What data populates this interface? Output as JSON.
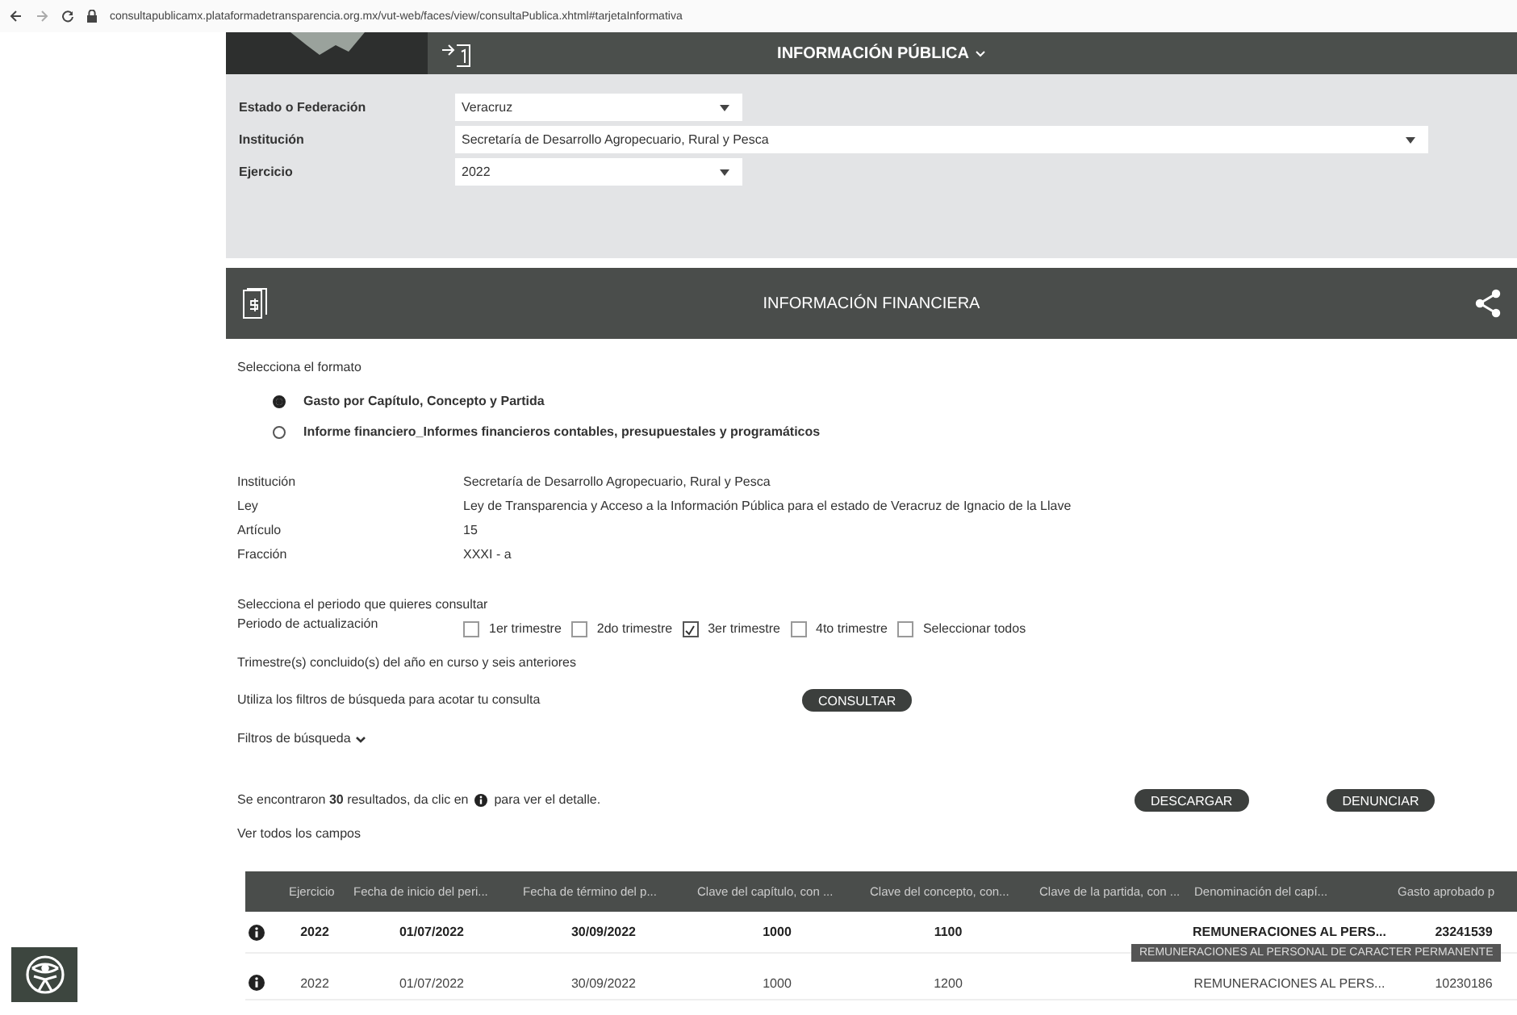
{
  "browser": {
    "url": "consultapublicamx.plataformadetransparencia.org.mx/vut-web/faces/view/consultaPublica.xhtml#tarjetaInformativa"
  },
  "header": {
    "title": "INFORMACIÓN PÚBLICA"
  },
  "filters": [
    {
      "label": "Estado o Federación",
      "value": "Veracruz",
      "wide": false
    },
    {
      "label": "Institución",
      "value": "Secretaría de Desarrollo Agropecuario, Rural y Pesca",
      "wide": true
    },
    {
      "label": "Ejercicio",
      "value": "2022",
      "wide": false
    }
  ],
  "section": {
    "title": "INFORMACIÓN FINANCIERA"
  },
  "format": {
    "prompt": "Selecciona el formato",
    "options": [
      {
        "label": "Gasto por Capítulo, Concepto y Partida",
        "selected": true
      },
      {
        "label": "Informe financiero_Informes financieros contables, presupuestales y programáticos",
        "selected": false
      }
    ]
  },
  "details": [
    {
      "label": "Institución",
      "value": "Secretaría de Desarrollo Agropecuario, Rural y Pesca"
    },
    {
      "label": "Ley",
      "value": "Ley de Transparencia y Acceso a la Información Pública para el estado de Veracruz de Ignacio de la Llave"
    },
    {
      "label": "Artículo",
      "value": "15"
    },
    {
      "label": "Fracción",
      "value": "XXXI - a"
    }
  ],
  "period": {
    "prompt": "Selecciona el periodo que quieres consultar",
    "label": "Periodo de actualización",
    "options": [
      {
        "label": "1er trimestre",
        "checked": false
      },
      {
        "label": "2do trimestre",
        "checked": false
      },
      {
        "label": "3er trimestre",
        "checked": true
      },
      {
        "label": "4to trimestre",
        "checked": false
      },
      {
        "label": "Seleccionar todos",
        "checked": false
      }
    ],
    "note": "Trimestre(s) concluido(s) del año en curso y seis anteriores"
  },
  "search": {
    "hint": "Utiliza los filtros de búsqueda para acotar tu consulta",
    "button": "CONSULTAR",
    "filters_toggle": "Filtros de búsqueda"
  },
  "results": {
    "before": "Se encontraron **30** resultados, da clic en",
    "after": "para ver el detalle.",
    "buttons": [
      "DESCARGAR",
      "DENUNCIAR"
    ],
    "show_all": "Ver todos los campos"
  },
  "table": {
    "columns": [
      "Ejercicio",
      "Fecha de inicio del peri...",
      "Fecha de término del p...",
      "Clave del capítulo, con ...",
      "Clave del concepto, con...",
      "Clave de la partida, con ...",
      "Denominación del capí...",
      "Gasto aprobado p"
    ],
    "rows": [
      {
        "highlighted": true,
        "cells": [
          "2022",
          "01/07/2022",
          "30/09/2022",
          "1000",
          "1100",
          null,
          "REMUNERACIONES AL PERS...",
          "23241539"
        ]
      },
      {
        "highlighted": false,
        "cells": [
          "2022",
          "01/07/2022",
          "30/09/2022",
          "1000",
          "1200",
          null,
          "REMUNERACIONES AL PERS...",
          "10230186"
        ]
      }
    ]
  },
  "tooltip": {
    "text": "REMUNERACIONES AL PERSONAL DE CARACTER PERMANENTE"
  }
}
